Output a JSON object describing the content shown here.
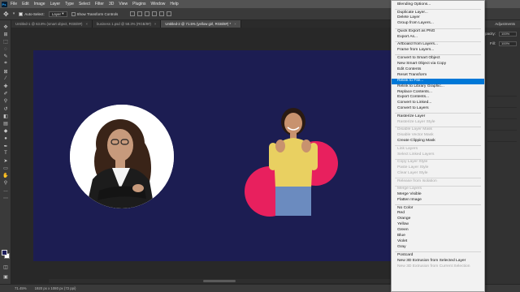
{
  "menubar": {
    "logo": "Ps",
    "items": [
      "File",
      "Edit",
      "Image",
      "Layer",
      "Type",
      "Select",
      "Filter",
      "3D",
      "View",
      "Plugins",
      "Window",
      "Help"
    ]
  },
  "options": {
    "auto_select_label": "Auto-Select:",
    "auto_select_value": "Layer",
    "transform_label": "Show Transform Controls"
  },
  "tabs": [
    {
      "label": "Untitled-1 @ 63.8% (smart object, RGB/8#)",
      "close": "×"
    },
    {
      "label": "business 1.psd @ 58.3% (RGB/8#)",
      "close": "×"
    },
    {
      "label": "Untitled-2 @ 71.5% (yellow girl, RGB/8#) *",
      "close": "×"
    }
  ],
  "status": {
    "zoom": "71.45%",
    "doc_info": "1920 px x 1080 px (72 ppi)"
  },
  "panel": {
    "head_label": "Adjustments",
    "opacity_label": "Opacity:",
    "opacity_value": "100%",
    "fill_label": "Fill:",
    "fill_value": "100%"
  },
  "context_menu": {
    "items": [
      {
        "label": "Blending Options...",
        "state": "normal"
      },
      {
        "sep": true
      },
      {
        "label": "Duplicate Layer...",
        "state": "normal"
      },
      {
        "label": "Delete Layer",
        "state": "normal"
      },
      {
        "label": "Group from Layers...",
        "state": "normal"
      },
      {
        "sep": true
      },
      {
        "label": "Quick Export as PNG",
        "state": "normal"
      },
      {
        "label": "Export As...",
        "state": "normal"
      },
      {
        "sep": true
      },
      {
        "label": "Artboard from Layers...",
        "state": "normal"
      },
      {
        "label": "Frame from Layers...",
        "state": "normal"
      },
      {
        "sep": true
      },
      {
        "label": "Convert to Smart Object",
        "state": "normal"
      },
      {
        "label": "New Smart Object via Copy",
        "state": "normal"
      },
      {
        "label": "Edit Contents",
        "state": "normal"
      },
      {
        "label": "Reset Transform",
        "state": "normal"
      },
      {
        "label": "Relink to File...",
        "state": "hover"
      },
      {
        "label": "Relink to Library Graphic...",
        "state": "normal"
      },
      {
        "label": "Replace Contents...",
        "state": "normal"
      },
      {
        "label": "Export Contents...",
        "state": "normal"
      },
      {
        "label": "Convert to Linked...",
        "state": "normal"
      },
      {
        "label": "Convert to Layers",
        "state": "normal"
      },
      {
        "sep": true
      },
      {
        "label": "Rasterize Layer",
        "state": "normal"
      },
      {
        "label": "Rasterize Layer Style",
        "state": "disabled"
      },
      {
        "sep": true
      },
      {
        "label": "Disable Layer Mask",
        "state": "disabled"
      },
      {
        "label": "Disable Vector Mask",
        "state": "disabled"
      },
      {
        "label": "Create Clipping Mask",
        "state": "normal"
      },
      {
        "sep": true
      },
      {
        "label": "Link Layers",
        "state": "disabled"
      },
      {
        "label": "Select Linked Layers",
        "state": "disabled"
      },
      {
        "sep": true
      },
      {
        "label": "Copy Layer Style",
        "state": "disabled"
      },
      {
        "label": "Paste Layer Style",
        "state": "disabled"
      },
      {
        "label": "Clear Layer Style",
        "state": "disabled"
      },
      {
        "sep": true
      },
      {
        "label": "Release from Isolation",
        "state": "disabled"
      },
      {
        "sep": true
      },
      {
        "label": "Merge Layers",
        "state": "disabled"
      },
      {
        "label": "Merge Visible",
        "state": "normal"
      },
      {
        "label": "Flatten Image",
        "state": "normal"
      },
      {
        "sep": true
      },
      {
        "label": "No Color",
        "state": "normal"
      },
      {
        "label": "Red",
        "state": "normal"
      },
      {
        "label": "Orange",
        "state": "normal"
      },
      {
        "label": "Yellow",
        "state": "normal"
      },
      {
        "label": "Green",
        "state": "normal"
      },
      {
        "label": "Blue",
        "state": "normal"
      },
      {
        "label": "Violet",
        "state": "normal"
      },
      {
        "label": "Gray",
        "state": "normal"
      },
      {
        "sep": true
      },
      {
        "label": "Postcard",
        "state": "normal"
      },
      {
        "label": "New 3D Extrusion from Selected Layer",
        "state": "normal"
      },
      {
        "label": "New 3D Extrusion from Current Selection",
        "state": "disabled"
      }
    ]
  },
  "colors": {
    "canvas": "#1c1d52",
    "accent_pink": "#e8205e",
    "hover_blue": "#0078d7"
  }
}
